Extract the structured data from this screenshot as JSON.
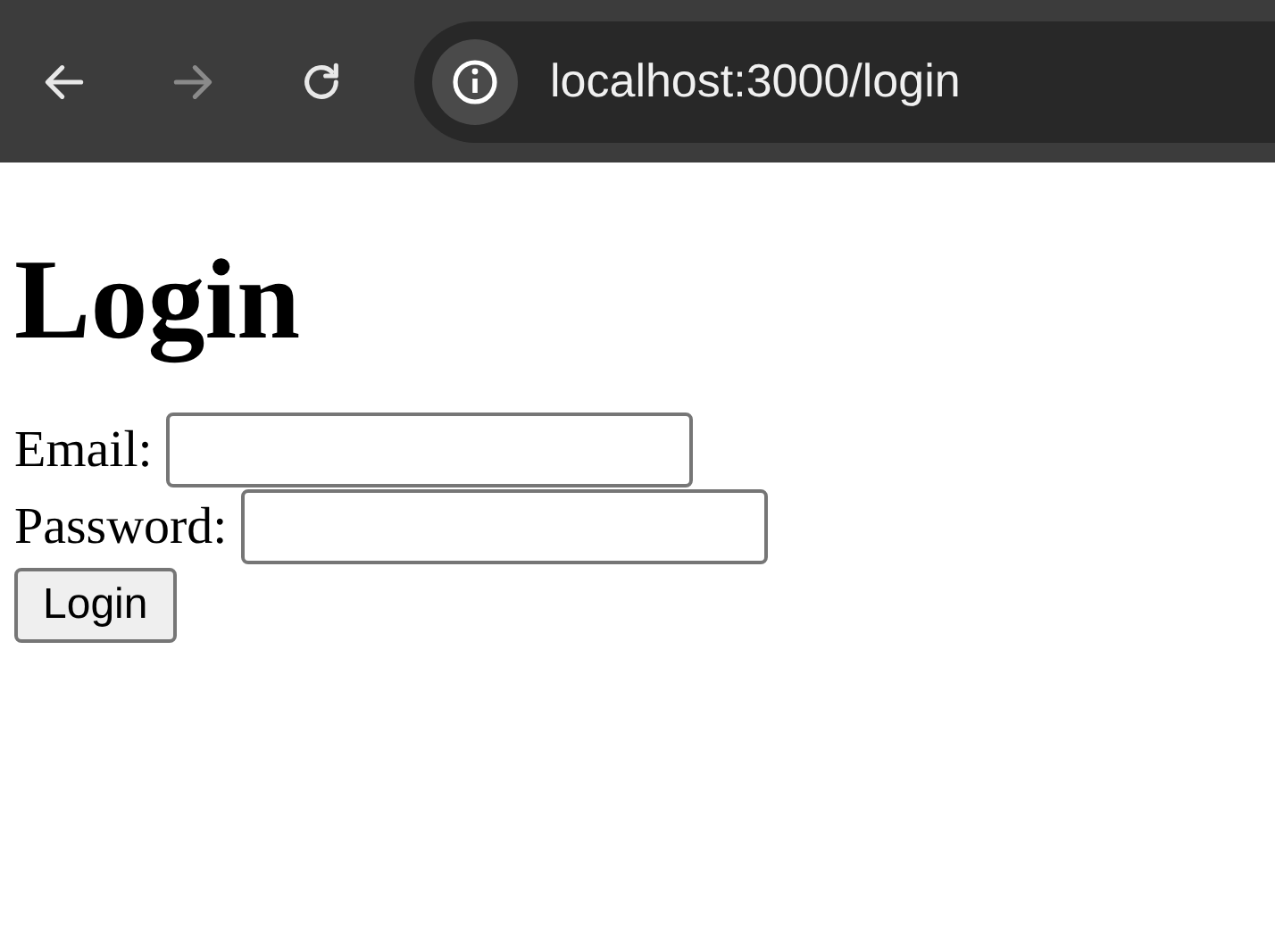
{
  "browser": {
    "back": {
      "disabled": false
    },
    "forward": {
      "disabled": true
    },
    "url": "localhost:3000/login"
  },
  "page": {
    "title": "Login",
    "fields": [
      {
        "label": "Email:"
      },
      {
        "label": "Password:"
      }
    ],
    "button": "Login"
  }
}
